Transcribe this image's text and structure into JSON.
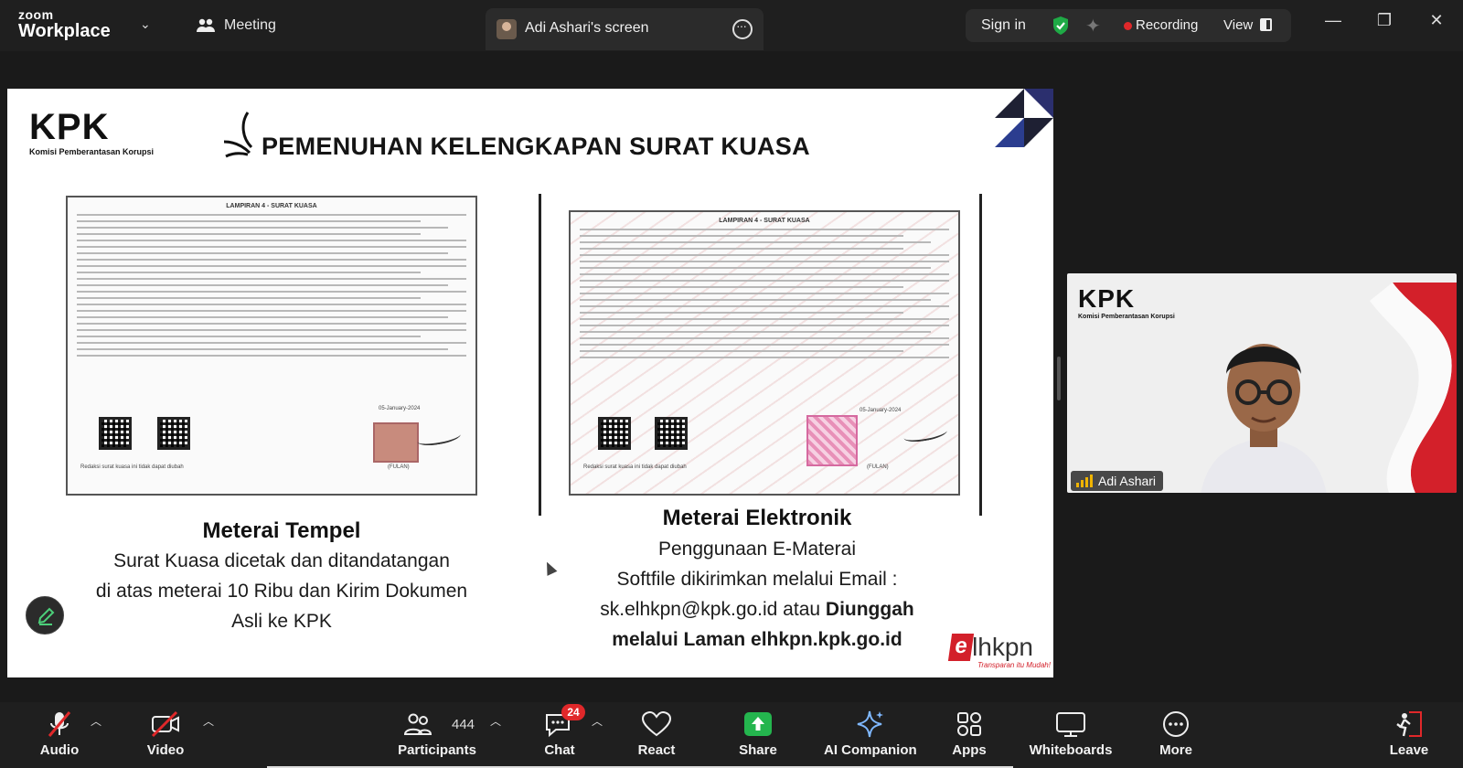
{
  "app": {
    "logo_top": "zoom",
    "logo_bottom": "Workplace",
    "meeting_label": "Meeting",
    "screen_share_label": "Adi Ashari's screen",
    "sign_in": "Sign in",
    "recording": "Recording",
    "view": "View",
    "colors": {
      "bar_bg": "#1f1f1f",
      "recording_red": "#e0282a",
      "shield_green": "#1faa46",
      "badge_red": "#e0282a"
    }
  },
  "slide": {
    "logo_big": "KPK",
    "logo_small": "Komisi Pemberantasan Korupsi",
    "title": "PEMENUHAN KELENGKAPAN SURAT KUASA",
    "left_doc": {
      "header": "LAMPIRAN 4 - SURAT KUASA",
      "date": "05-January-2024",
      "fulan": "(FULAN)",
      "note": "Redaksi surat kuasa ini tidak dapat diubah"
    },
    "right_doc": {
      "header": "LAMPIRAN 4 - SURAT KUASA",
      "date": "05-January-2024",
      "fulan": "(FULAN)",
      "note": "Redaksi surat kuasa ini tidak dapat diubah"
    },
    "left_caption": {
      "heading": "Meterai Tempel",
      "line1": "Surat Kuasa dicetak dan ditandatangan",
      "line2": "di atas meterai 10 Ribu dan Kirim Dokumen",
      "line3": "Asli ke KPK"
    },
    "right_caption": {
      "heading": "Meterai Elektronik",
      "line1": "Penggunaan E-Materai",
      "line2": "Softfile dikirimkan melalui Email :",
      "line3_plain": "sk.elhkpn@kpk.go.id atau ",
      "line3_bold": "Diunggah",
      "line4": "melalui Laman elhkpn.kpk.go.id"
    },
    "elhkpn_e": "e",
    "elhkpn_word": "lhkpn",
    "elhkpn_tagline": "Transparan itu Mudah!"
  },
  "video_tile": {
    "logo_big": "KPK",
    "logo_small": "Komisi Pemberantasan Korupsi",
    "participant_name": "Adi Ashari"
  },
  "toolbar": {
    "audio": "Audio",
    "video": "Video",
    "participants": "Participants",
    "participants_count": "444",
    "chat": "Chat",
    "chat_badge": "24",
    "react": "React",
    "share": "Share",
    "ai_companion": "AI Companion",
    "apps": "Apps",
    "whiteboards": "Whiteboards",
    "more": "More",
    "leave": "Leave"
  }
}
